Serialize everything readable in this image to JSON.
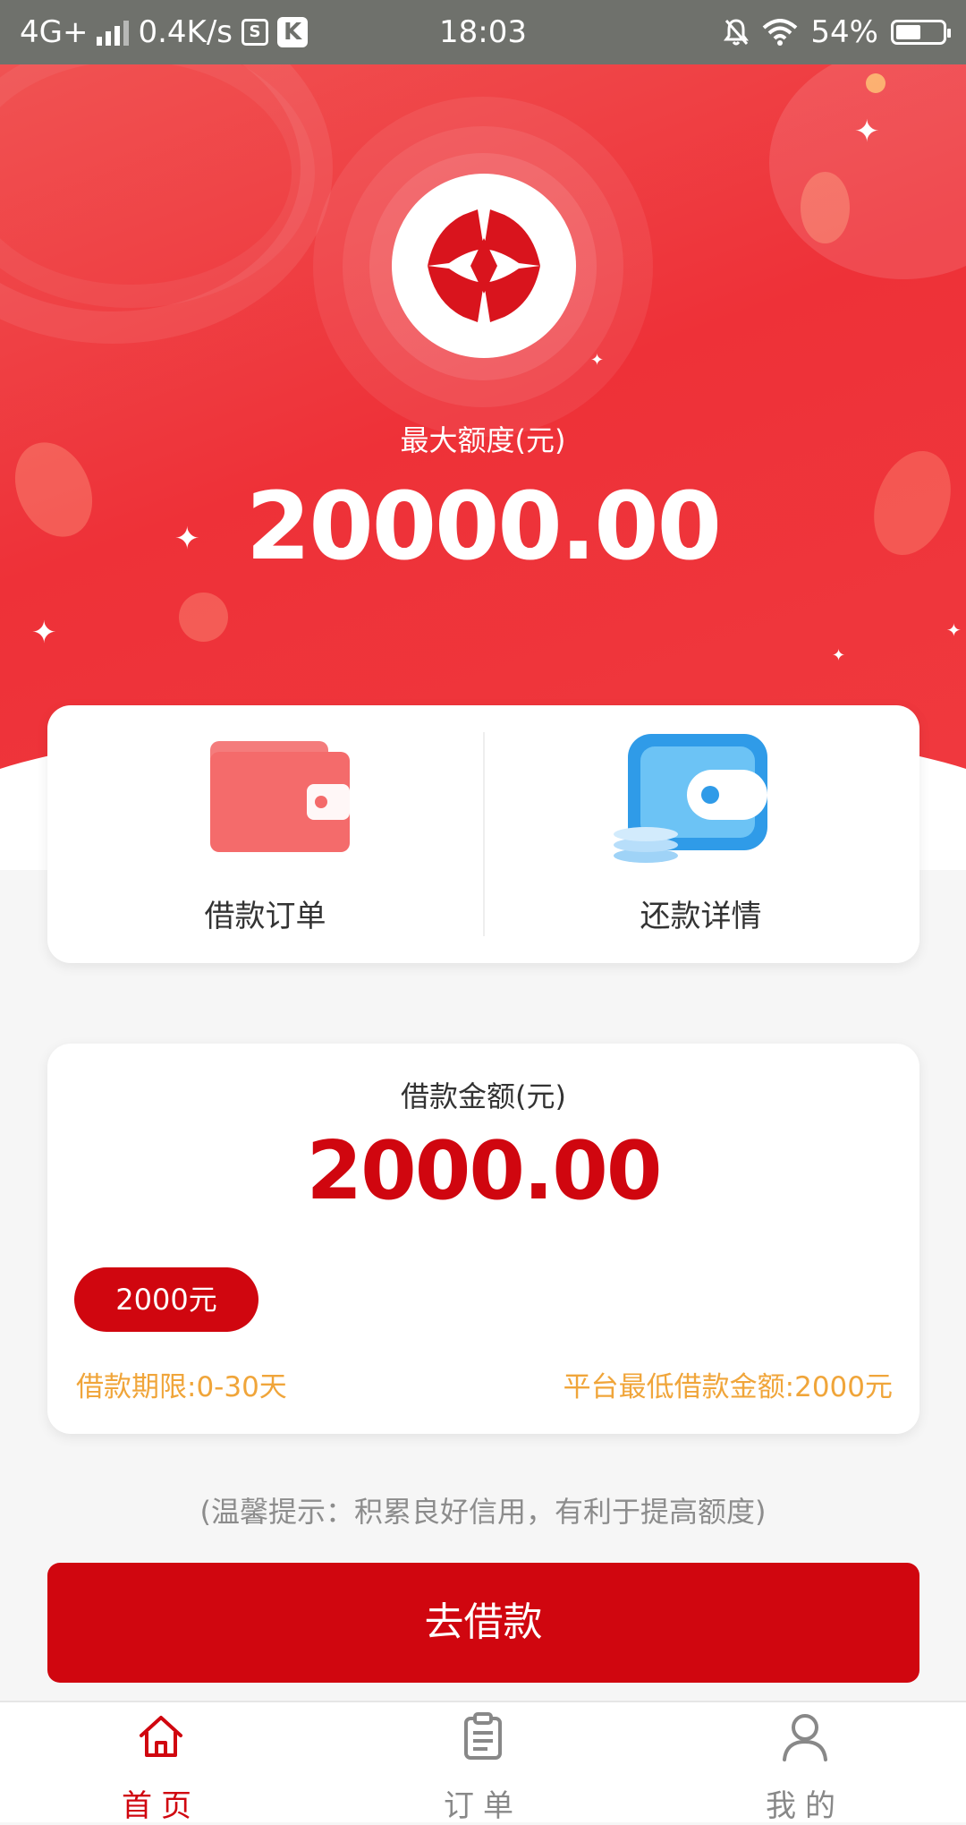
{
  "status_bar": {
    "network": "4G+",
    "speed": "0.4K/s",
    "time": "18:03",
    "battery": "54%",
    "battery_level": 0.54
  },
  "hero": {
    "label": "最大额度(元)",
    "amount": "20000.00"
  },
  "quick_actions": [
    {
      "label": "借款订单",
      "icon": "wallet-icon",
      "color": "#f46b6b"
    },
    {
      "label": "还款详情",
      "icon": "wallet-coins-icon",
      "color": "#2f9be8"
    }
  ],
  "loan": {
    "label": "借款金额(元)",
    "amount": "2000.00",
    "chip": "2000元",
    "term": "借款期限:0-30天",
    "minimum": "平台最低借款金额:2000元"
  },
  "tip": "(温馨提示：积累良好信用，有利于提高额度)",
  "submit_label": "去借款",
  "tabs": [
    {
      "label": "首页",
      "icon": "home-icon",
      "active": true
    },
    {
      "label": "订单",
      "icon": "clipboard-icon",
      "active": false
    },
    {
      "label": "我的",
      "icon": "user-icon",
      "active": false
    }
  ],
  "colors": {
    "brand_red": "#d0060f",
    "hero_red": "#ee3138",
    "accent_orange": "#f0a53a"
  }
}
